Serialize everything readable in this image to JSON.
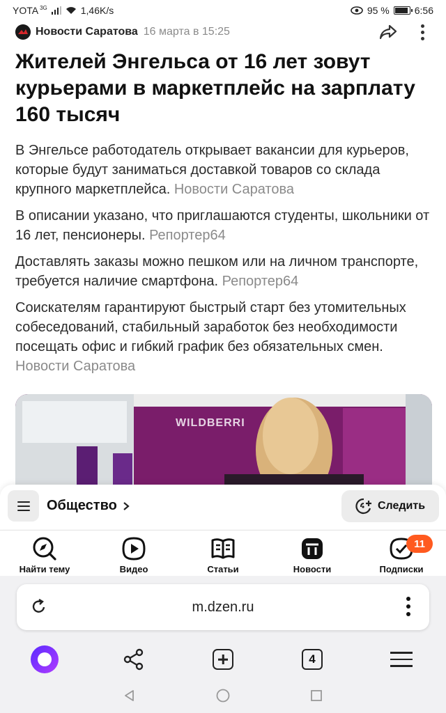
{
  "status_bar": {
    "carrier": "YOTA",
    "network_type": "3G",
    "speed": "1,46K/s",
    "battery": "95 %",
    "battery_level": 0.95,
    "time": "6:56"
  },
  "source": {
    "name": "Новости Саратова",
    "date": "16 марта в 15:25"
  },
  "article": {
    "title": "Жителей Энгельса от 16 лет зовут курьерами в маркетплейс на зарплату 160 тысяч",
    "paragraphs": [
      {
        "text": "В Энгельсе работодатель открывает вакансии для курьеров, которые будут заниматься доставкой товаров со склада крупного маркетплейса.",
        "source": "Новости Саратова"
      },
      {
        "text": "В описании указано, что приглашаются студенты, школьники от 16 лет, пенсионеры.",
        "source": "Репортер64"
      },
      {
        "text": "Доставлять заказы можно пешком или на личном транспорте, требуется наличие смартфона.",
        "source": "Репортер64"
      },
      {
        "text": "Соискателям гарантируют быстрый старт без утомительных собеседований, стабильный заработок без необходимости посещать офис и гибкий график без обязательных смен.",
        "source": "Новости Саратова"
      }
    ],
    "image_sign": "WILDBERRI"
  },
  "topic_bar": {
    "topic": "Общество",
    "follow_label": "Следить"
  },
  "bottom_nav": {
    "items": [
      {
        "label": "Найти тему",
        "icon": "compass-icon"
      },
      {
        "label": "Видео",
        "icon": "play-icon"
      },
      {
        "label": "Статьи",
        "icon": "book-icon"
      },
      {
        "label": "Новости",
        "icon": "news-icon"
      },
      {
        "label": "Подписки",
        "icon": "subscriptions-icon",
        "badge": "11"
      }
    ]
  },
  "browser": {
    "url": "m.dzen.ru",
    "tabs_count": "4"
  },
  "colors": {
    "badge": "#ff5a1f",
    "alice_gradient_start": "#5a2bff",
    "alice_gradient_end": "#b03cff",
    "secondary_text": "#8a8a8a"
  }
}
